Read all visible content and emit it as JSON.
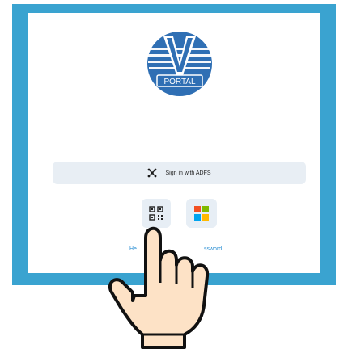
{
  "app": {
    "logo_text": "PORTAL",
    "colors": {
      "frame": "#3aa3d0",
      "logo_blue": "#2f6fb4",
      "button_bg": "#e8eef4",
      "link": "#2b8fd3"
    }
  },
  "signin": {
    "adfs_label": "Sign in with ADFS",
    "adfs_icon": "network-icon"
  },
  "options": {
    "qr_icon": "qr-code-icon",
    "microsoft_icon": "microsoft-icon"
  },
  "links": {
    "help_partial": "He",
    "password_partial": "ssword"
  }
}
